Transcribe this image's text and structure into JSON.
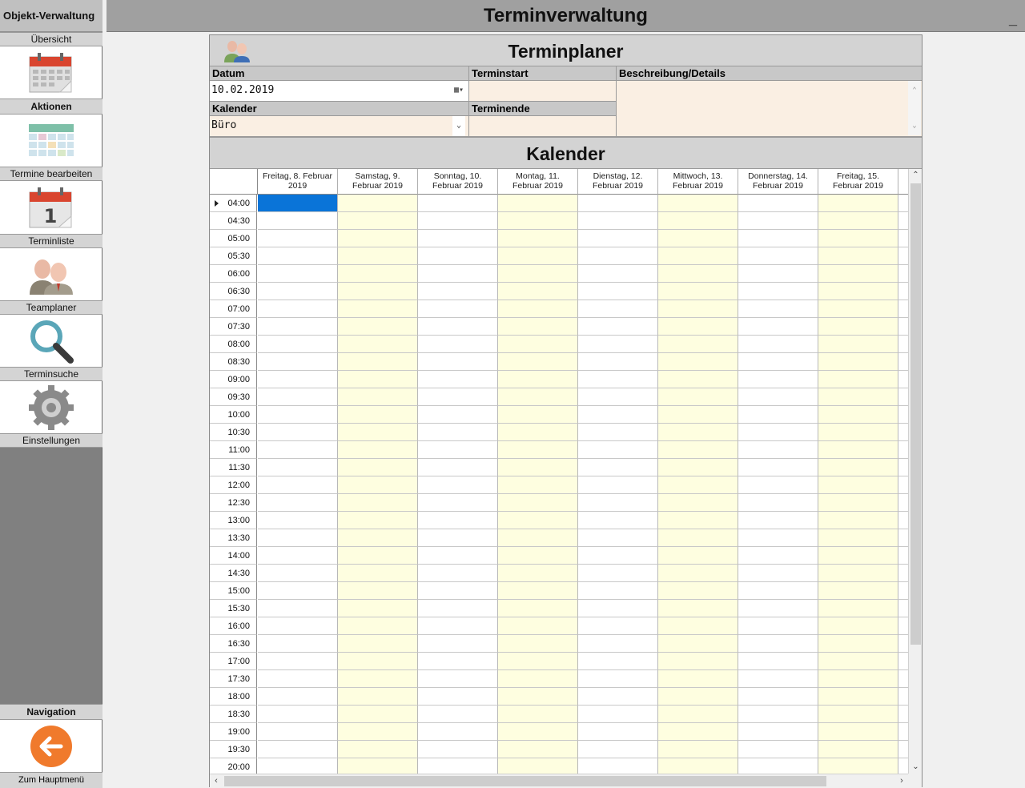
{
  "sidebar": {
    "title": "Objekt-Verwaltung",
    "overview_label": "Übersicht",
    "actions_header": "Aktionen",
    "items": [
      {
        "label": "Termine bearbeiten",
        "icon": "calendar-grid-icon"
      },
      {
        "label": "Terminliste",
        "icon": "calendar-one-icon"
      },
      {
        "label": "Teamplaner",
        "icon": "team-icon"
      },
      {
        "label": "Terminsuche",
        "icon": "magnifier-icon"
      },
      {
        "label": "Einstellungen",
        "icon": "gear-icon"
      }
    ],
    "navigation_header": "Navigation",
    "back_label": "Zum Hauptmenü"
  },
  "header": {
    "title": "Terminverwaltung",
    "minimize": "_"
  },
  "planner": {
    "title": "Terminplaner",
    "datum_label": "Datum",
    "datum_value": "10.02.2019",
    "terminstart_label": "Terminstart",
    "terminstart_value": "",
    "beschreibung_label": "Beschreibung/Details",
    "beschreibung_value": "",
    "kalender_label": "Kalender",
    "kalender_value": "Büro",
    "terminende_label": "Terminende",
    "terminende_value": ""
  },
  "calendar": {
    "title": "Kalender",
    "columns": [
      {
        "line1": "Freitag, 8. Februar",
        "line2": "2019",
        "weekend_tint": false
      },
      {
        "line1": "Samstag, 9.",
        "line2": "Februar 2019",
        "weekend_tint": true
      },
      {
        "line1": "Sonntag, 10.",
        "line2": "Februar 2019",
        "weekend_tint": false
      },
      {
        "line1": "Montag, 11.",
        "line2": "Februar 2019",
        "weekend_tint": true
      },
      {
        "line1": "Dienstag, 12.",
        "line2": "Februar 2019",
        "weekend_tint": false
      },
      {
        "line1": "Mittwoch, 13.",
        "line2": "Februar 2019",
        "weekend_tint": true
      },
      {
        "line1": "Donnerstag, 14.",
        "line2": "Februar 2019",
        "weekend_tint": false
      },
      {
        "line1": "Freitag, 15.",
        "line2": "Februar 2019",
        "weekend_tint": true
      }
    ],
    "times": [
      "04:00",
      "04:30",
      "05:00",
      "05:30",
      "06:00",
      "06:30",
      "07:00",
      "07:30",
      "08:00",
      "08:30",
      "09:00",
      "09:30",
      "10:00",
      "10:30",
      "11:00",
      "11:30",
      "12:00",
      "12:30",
      "13:00",
      "13:30",
      "14:00",
      "14:30",
      "15:00",
      "15:30",
      "16:00",
      "16:30",
      "17:00",
      "17:30",
      "18:00",
      "18:30",
      "19:00",
      "19:30",
      "20:00"
    ],
    "selected_cell": {
      "row": 0,
      "col": 0
    }
  },
  "colors": {
    "selection": "#0a74d8",
    "tint_yellow": "#fefee0",
    "tint_peach": "#faefe3",
    "back_button": "#f07a2c"
  }
}
